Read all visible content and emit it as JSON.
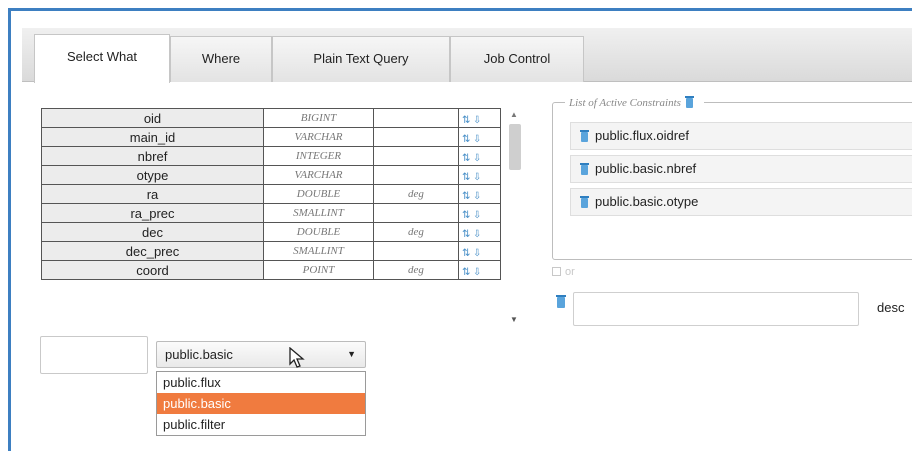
{
  "tabs": [
    {
      "label": "Select What",
      "active": true
    },
    {
      "label": "Where",
      "active": false
    },
    {
      "label": "Plain Text Query",
      "active": false
    },
    {
      "label": "Job Control",
      "active": false
    }
  ],
  "columns": [
    {
      "name": "oid",
      "type": "BIGINT",
      "unit": ""
    },
    {
      "name": "main_id",
      "type": "VARCHAR",
      "unit": ""
    },
    {
      "name": "nbref",
      "type": "INTEGER",
      "unit": ""
    },
    {
      "name": "otype",
      "type": "VARCHAR",
      "unit": ""
    },
    {
      "name": "ra",
      "type": "DOUBLE",
      "unit": "deg"
    },
    {
      "name": "ra_prec",
      "type": "SMALLINT",
      "unit": ""
    },
    {
      "name": "dec",
      "type": "DOUBLE",
      "unit": "deg"
    },
    {
      "name": "dec_prec",
      "type": "SMALLINT",
      "unit": ""
    },
    {
      "name": "coord",
      "type": "POINT",
      "unit": "deg"
    }
  ],
  "constraints": {
    "legend": "List of Active Constraints",
    "items": [
      "public.flux.oidref",
      "public.basic.nbref",
      "public.basic.otype"
    ]
  },
  "sort": {
    "or_label": "or",
    "direction": "desc",
    "value": ""
  },
  "table_selector": {
    "input_value": "",
    "selected": "public.basic",
    "options": [
      "public.flux",
      "public.basic",
      "public.filter"
    ],
    "highlighted_index": 1
  },
  "colors": {
    "accent_border": "#3d7fc1",
    "selection": "#f07b3f",
    "link_icon": "#4a90c8"
  }
}
